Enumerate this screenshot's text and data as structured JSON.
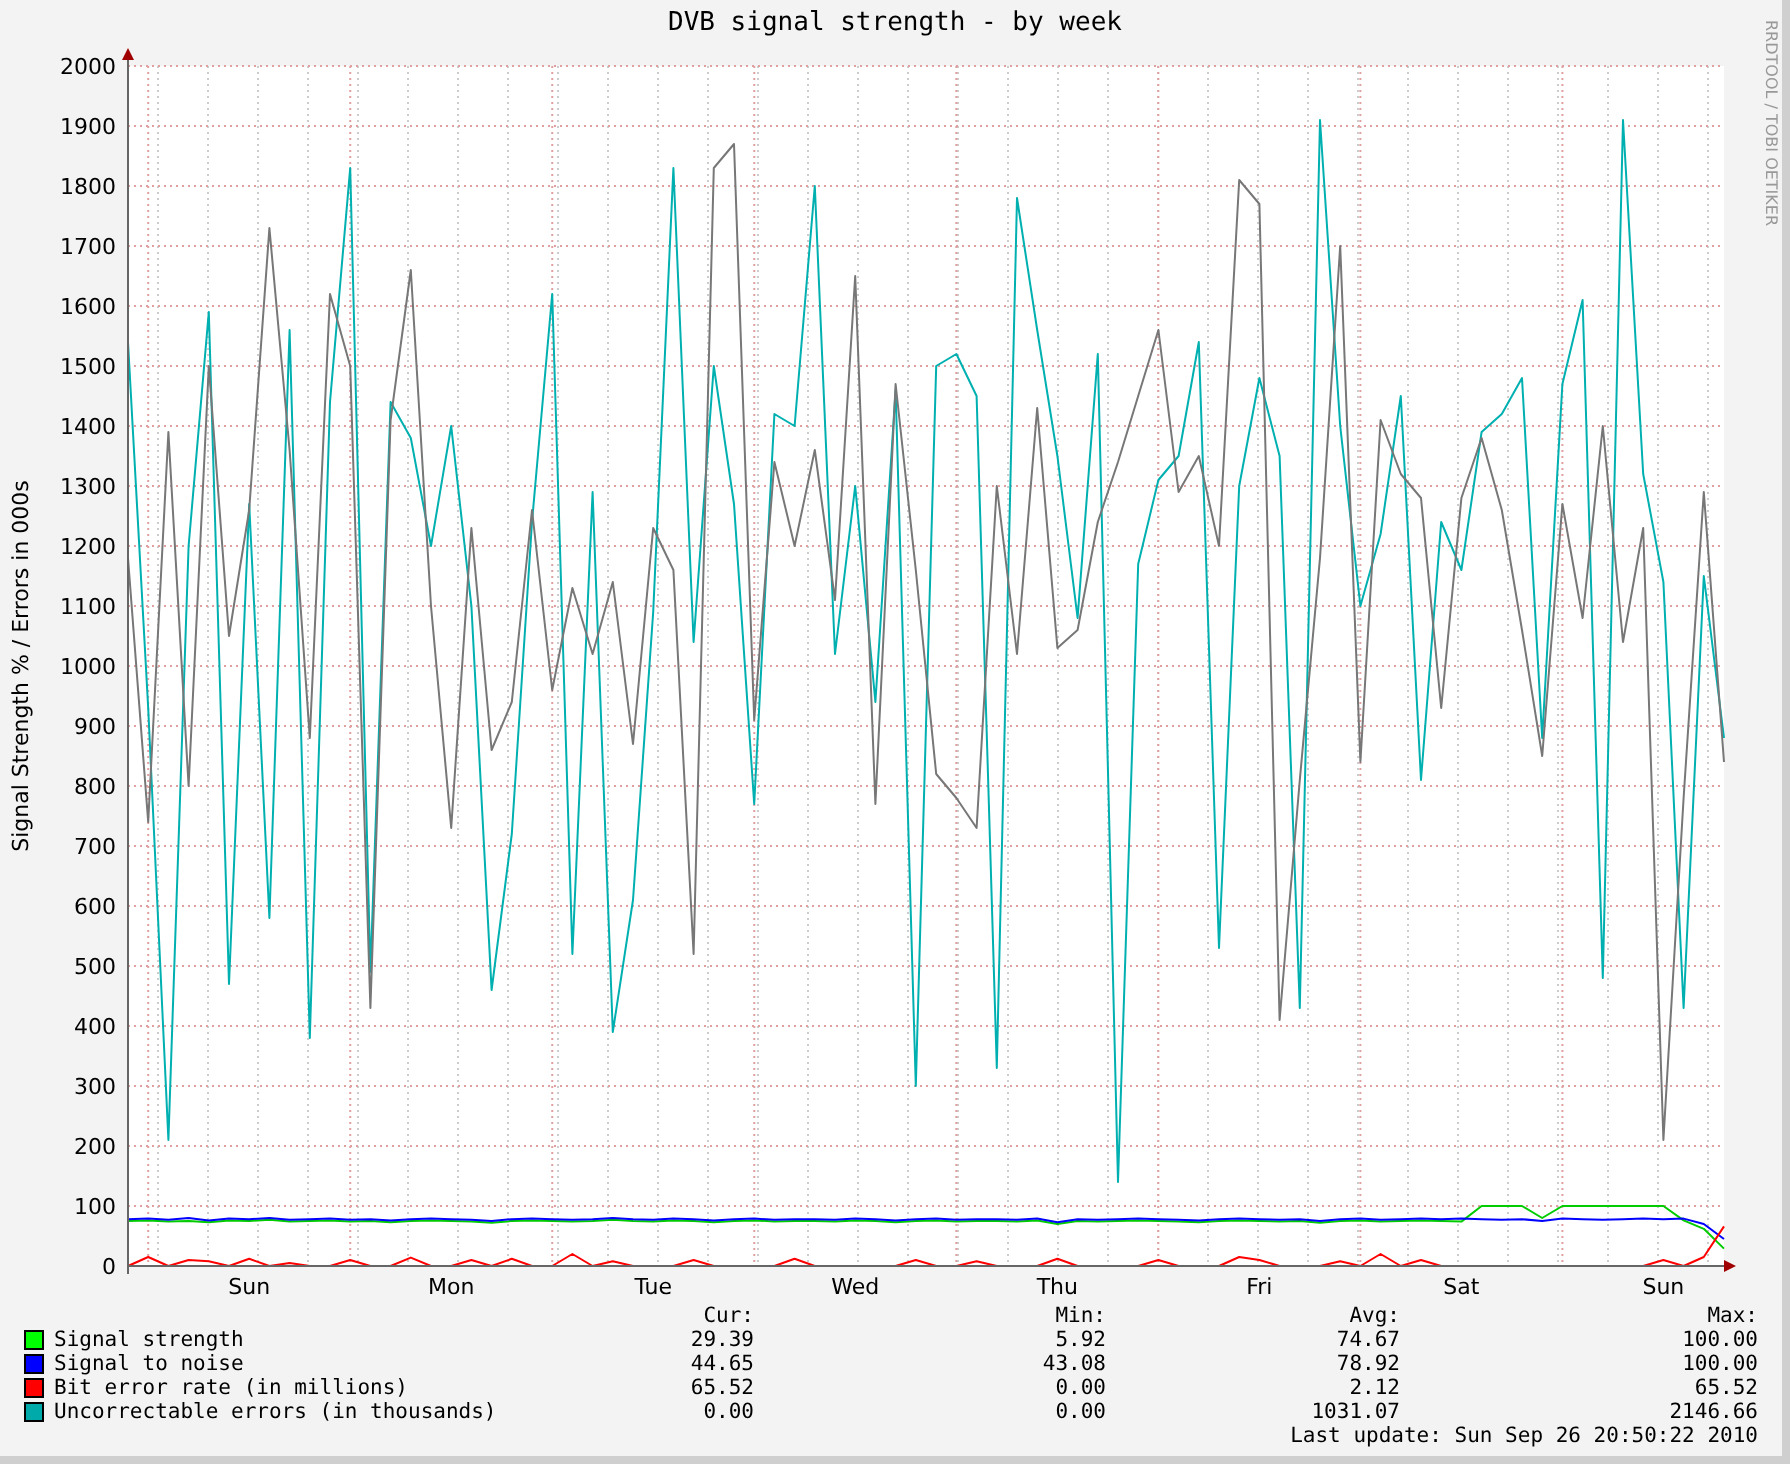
{
  "title": "DVB signal strength - by week",
  "credit": "RRDTOOL / TOBI OETIKER",
  "chart_data": {
    "type": "line",
    "ylabel": "Signal Strength % / Errors in 000s",
    "grid": true,
    "ylim": [
      0,
      2000
    ],
    "categories": [
      null,
      null,
      null,
      null,
      null,
      null,
      "Sun",
      null,
      null,
      null,
      null,
      null,
      null,
      null,
      null,
      null,
      "Mon",
      null,
      null,
      null,
      null,
      null,
      null,
      null,
      null,
      null,
      "Tue",
      null,
      null,
      null,
      null,
      null,
      null,
      null,
      null,
      null,
      "Wed",
      null,
      null,
      null,
      null,
      null,
      null,
      null,
      null,
      null,
      "Thu",
      null,
      null,
      null,
      null,
      null,
      null,
      null,
      null,
      null,
      "Fri",
      null,
      null,
      null,
      null,
      null,
      null,
      null,
      null,
      null,
      "Sat",
      null,
      null,
      null,
      null,
      null,
      null,
      null,
      null,
      null,
      "Sun",
      null,
      null,
      null
    ],
    "yticks": [
      0,
      100,
      200,
      300,
      400,
      500,
      600,
      700,
      800,
      900,
      1000,
      1100,
      1200,
      1300,
      1400,
      1500,
      1600,
      1700,
      1800,
      1900,
      2000
    ],
    "series": [
      {
        "name": "Signal strength",
        "color": "#00cc00",
        "values": [
          75,
          76,
          74,
          75,
          73,
          76,
          75,
          77,
          74,
          75,
          76,
          74,
          75,
          73,
          75,
          76,
          75,
          74,
          72,
          75,
          76,
          75,
          74,
          75,
          77,
          75,
          74,
          76,
          75,
          73,
          75,
          76,
          74,
          75,
          75,
          74,
          76,
          75,
          73,
          75,
          76,
          74,
          75,
          75,
          74,
          76,
          70,
          75,
          74,
          75,
          76,
          75,
          74,
          73,
          75,
          76,
          75,
          74,
          75,
          72,
          75,
          76,
          74,
          75,
          76,
          75,
          74,
          100,
          100,
          100,
          80,
          100,
          100,
          100,
          100,
          100,
          100,
          76,
          62,
          29
        ]
      },
      {
        "name": "Signal to noise",
        "color": "#0000ff",
        "values": [
          78,
          79,
          77,
          80,
          76,
          79,
          78,
          80,
          77,
          78,
          79,
          77,
          78,
          76,
          78,
          79,
          78,
          77,
          75,
          78,
          79,
          78,
          77,
          78,
          80,
          78,
          77,
          79,
          78,
          76,
          78,
          79,
          77,
          78,
          78,
          77,
          79,
          78,
          76,
          78,
          79,
          77,
          78,
          78,
          77,
          79,
          73,
          78,
          77,
          78,
          79,
          78,
          77,
          76,
          78,
          79,
          78,
          77,
          78,
          75,
          78,
          79,
          77,
          78,
          79,
          78,
          79,
          78,
          77,
          78,
          75,
          79,
          78,
          77,
          78,
          79,
          78,
          79,
          70,
          45
        ]
      },
      {
        "name": "Bit error rate (in millions)",
        "color": "#ff0000",
        "values": [
          0,
          15,
          0,
          10,
          8,
          0,
          12,
          0,
          5,
          0,
          0,
          10,
          0,
          0,
          14,
          0,
          0,
          10,
          0,
          12,
          0,
          0,
          20,
          0,
          8,
          0,
          0,
          0,
          10,
          0,
          0,
          0,
          0,
          12,
          0,
          0,
          0,
          0,
          0,
          10,
          0,
          0,
          8,
          0,
          0,
          0,
          12,
          0,
          0,
          0,
          0,
          10,
          0,
          0,
          0,
          15,
          10,
          0,
          0,
          0,
          8,
          0,
          20,
          0,
          10,
          0,
          0,
          0,
          0,
          0,
          0,
          0,
          0,
          0,
          0,
          0,
          10,
          0,
          15,
          66
        ]
      },
      {
        "name": "Uncorrectable errors (in thousands)",
        "color": "#00b0b0",
        "values": [
          1540,
          930,
          210,
          1200,
          1590,
          470,
          1270,
          580,
          1560,
          380,
          1440,
          1830,
          490,
          1440,
          1380,
          1200,
          1400,
          1100,
          460,
          720,
          1240,
          1620,
          520,
          1290,
          390,
          610,
          1090,
          1830,
          1040,
          1500,
          1270,
          770,
          1420,
          1400,
          1800,
          1020,
          1300,
          940,
          1460,
          300,
          1500,
          1520,
          1450,
          330,
          1780,
          1560,
          1350,
          1080,
          1520,
          140,
          1170,
          1310,
          1350,
          1540,
          530,
          1300,
          1480,
          1350,
          430,
          1910,
          1400,
          1100,
          1220,
          1450,
          810,
          1240,
          1160,
          1390,
          1420,
          1480,
          880,
          1470,
          1610,
          480,
          1910,
          1320,
          1140,
          430,
          1150,
          880
        ]
      },
      {
        "color": "#777777",
        "values": [
          1180,
          740,
          1390,
          800,
          1500,
          1050,
          1260,
          1730,
          1360,
          880,
          1620,
          1500,
          430,
          1410,
          1660,
          1100,
          730,
          1230,
          860,
          940,
          1260,
          960,
          1130,
          1020,
          1140,
          870,
          1230,
          1160,
          520,
          1830,
          1870,
          910,
          1340,
          1200,
          1360,
          1110,
          1650,
          770,
          1470,
          1160,
          820,
          780,
          730,
          1300,
          1020,
          1430,
          1030,
          1060,
          1240,
          1340,
          1450,
          1560,
          1290,
          1350,
          1200,
          1810,
          1770,
          410,
          810,
          1180,
          1700,
          840,
          1410,
          1320,
          1280,
          930,
          1280,
          1380,
          1260,
          1060,
          850,
          1270,
          1080,
          1400,
          1040,
          1230,
          210,
          780,
          1290,
          840
        ]
      }
    ]
  },
  "legend": {
    "headers": [
      "Cur:",
      "Min:",
      "Avg:",
      "Max:"
    ],
    "rows": [
      {
        "color": "#00ff00",
        "cur": "29.39",
        "min": "5.92",
        "avg": "74.67",
        "max": "100.00"
      },
      {
        "color": "#0000ff",
        "cur": "44.65",
        "min": "43.08",
        "avg": "78.92",
        "max": "100.00"
      },
      {
        "color": "#ff0000",
        "cur": "65.52",
        "min": "0.00",
        "avg": "2.12",
        "max": "65.52"
      },
      {
        "color": "#00aaaa",
        "cur": "0.00",
        "min": "0.00",
        "avg": "1031.07",
        "max": "2146.66"
      }
    ]
  },
  "last_update": "Last update: Sun Sep 26 20:50:22 2010"
}
